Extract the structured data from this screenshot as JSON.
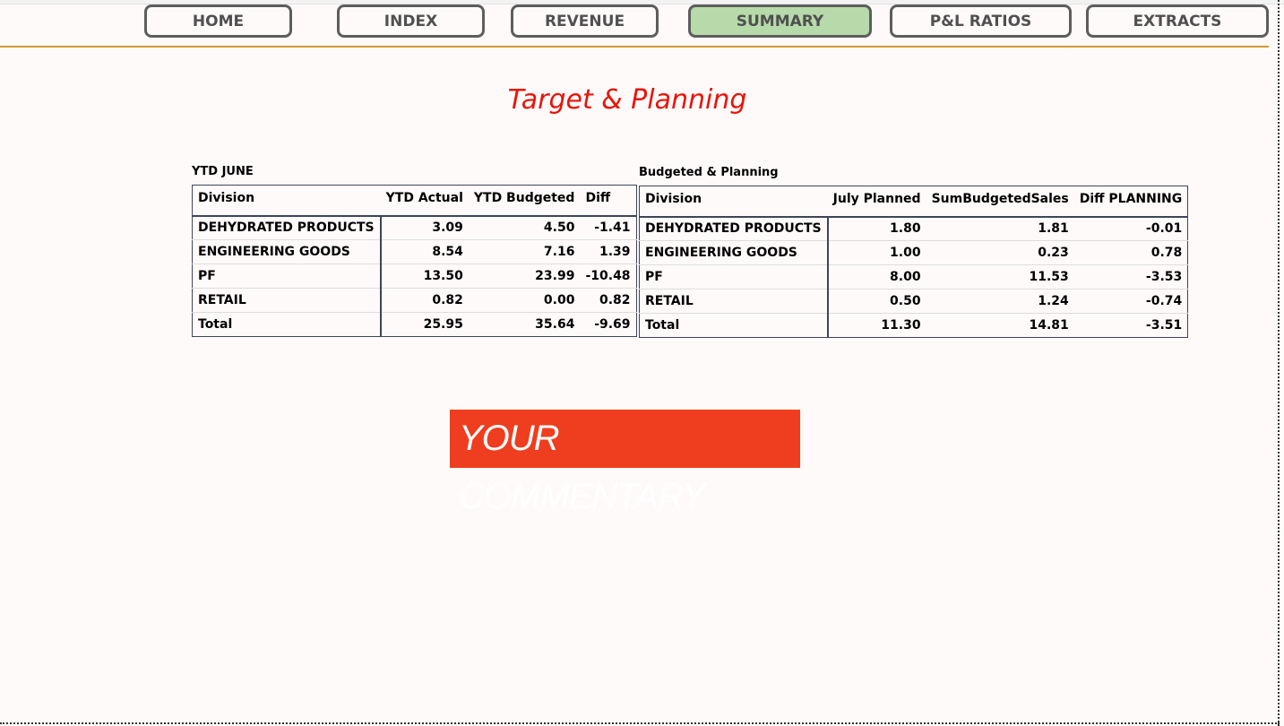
{
  "nav": {
    "home": "HOME",
    "index": "INDEX",
    "revenue": "REVENUE",
    "summary": "SUMMARY",
    "pl_ratios": "P&L RATIOS",
    "extracts": "EXTRACTS",
    "active": "SUMMARY"
  },
  "colors": {
    "title": "#e8150a",
    "active_button": "#b6daa9",
    "gold_line": "#d29a35",
    "commentary_bg": "#ee3e1f"
  },
  "page": {
    "title": "Target & Planning",
    "commentary": "YOUR COMMENTARY"
  },
  "ytd": {
    "label": "YTD JUNE",
    "headers": [
      "Division",
      "YTD Actual",
      "YTD Budgeted",
      "Diff"
    ],
    "rows": [
      [
        "DEHYDRATED PRODUCTS",
        "3.09",
        "4.50",
        "-1.41"
      ],
      [
        "ENGINEERING GOODS",
        "8.54",
        "7.16",
        "1.39"
      ],
      [
        "PF",
        "13.50",
        "23.99",
        "-10.48"
      ],
      [
        "RETAIL",
        "0.82",
        "0.00",
        "0.82"
      ],
      [
        "Total",
        "25.95",
        "35.64",
        "-9.69"
      ]
    ]
  },
  "planning": {
    "label": "Budgeted & Planning",
    "headers": [
      "Division",
      "July Planned",
      "SumBudgetedSales",
      "Diff PLANNING"
    ],
    "rows": [
      [
        "DEHYDRATED PRODUCTS",
        "1.80",
        "1.81",
        "-0.01"
      ],
      [
        "ENGINEERING GOODS",
        "1.00",
        "0.23",
        "0.78"
      ],
      [
        "PF",
        "8.00",
        "11.53",
        "-3.53"
      ],
      [
        "RETAIL",
        "0.50",
        "1.24",
        "-0.74"
      ],
      [
        "Total",
        "11.30",
        "14.81",
        "-3.51"
      ]
    ]
  }
}
